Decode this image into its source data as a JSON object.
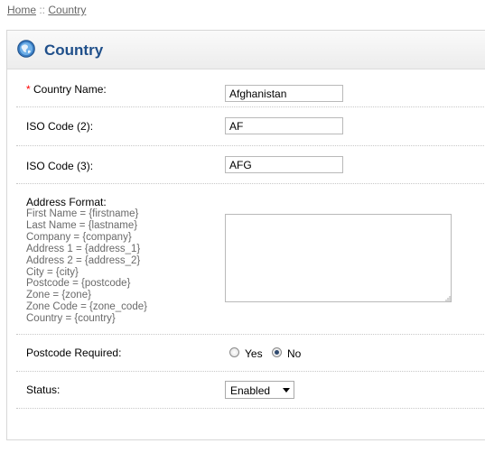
{
  "breadcrumb": {
    "home": "Home",
    "separator": " :: ",
    "current": "Country"
  },
  "heading": {
    "title": "Country",
    "icon": "globe-icon"
  },
  "form": {
    "required_mark": "*",
    "country_name": {
      "label": "Country Name:",
      "value": "Afghanistan"
    },
    "iso2": {
      "label": "ISO Code (2):",
      "value": "AF"
    },
    "iso3": {
      "label": "ISO Code (3):",
      "value": "AFG"
    },
    "address_format": {
      "label": "Address Format:",
      "hints": [
        "First Name = {firstname}",
        "Last Name = {lastname}",
        "Company = {company}",
        "Address 1 = {address_1}",
        "Address 2 = {address_2}",
        "City = {city}",
        "Postcode = {postcode}",
        "Zone = {zone}",
        "Zone Code = {zone_code}",
        "Country = {country}"
      ],
      "value": ""
    },
    "postcode_required": {
      "label": "Postcode Required:",
      "yes": "Yes",
      "no": "No",
      "selected": "No"
    },
    "status": {
      "label": "Status:",
      "value": "Enabled"
    }
  }
}
